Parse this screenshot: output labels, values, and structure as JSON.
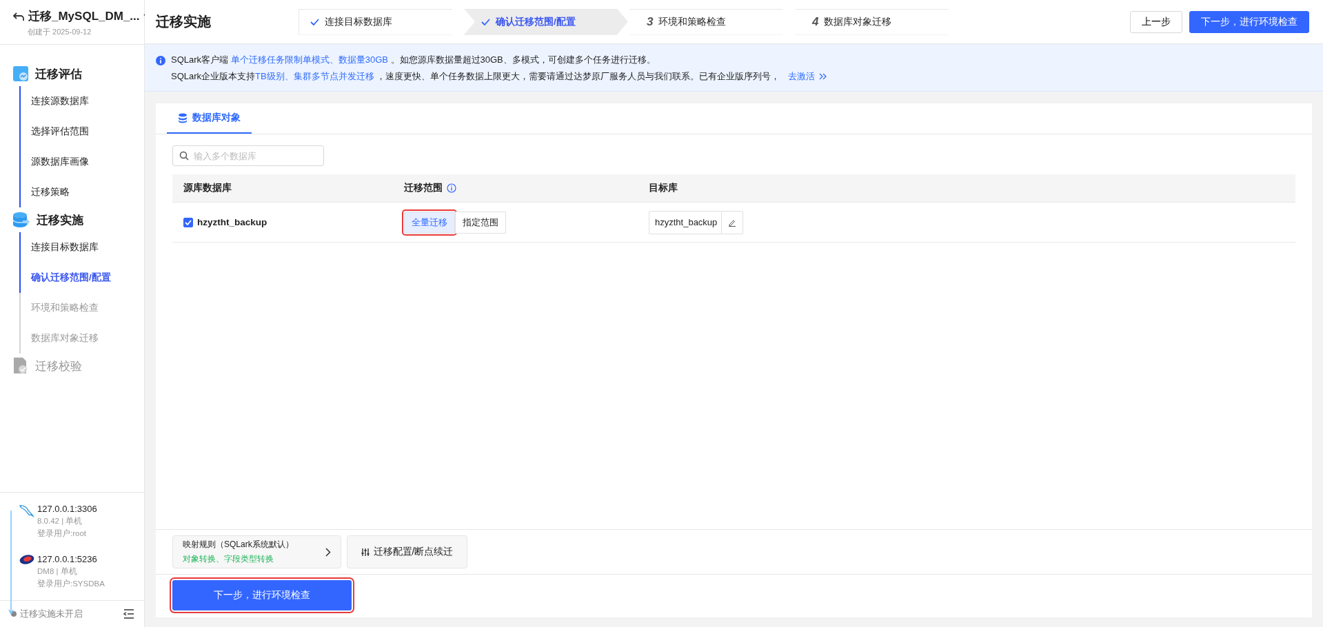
{
  "project": {
    "title": "迁移_MySQL_DM_...",
    "created": "创建于 2025-09-12"
  },
  "sidebar": {
    "stages": [
      {
        "title": "迁移评估",
        "disabled": false,
        "children": [
          {
            "label": "连接源数据库",
            "selected": false,
            "disabled": false
          },
          {
            "label": "选择评估范围",
            "selected": false,
            "disabled": false
          },
          {
            "label": "源数据库画像",
            "selected": false,
            "disabled": false
          },
          {
            "label": "迁移策略",
            "selected": false,
            "disabled": false
          }
        ]
      },
      {
        "title": "迁移实施",
        "disabled": false,
        "children": [
          {
            "label": "连接目标数据库",
            "selected": false,
            "disabled": false
          },
          {
            "label": "确认迁移范围/配置",
            "selected": true,
            "disabled": false
          },
          {
            "label": "环境和策略检查",
            "selected": false,
            "disabled": true
          },
          {
            "label": "数据库对象迁移",
            "selected": false,
            "disabled": true
          }
        ]
      },
      {
        "title": "迁移校验",
        "disabled": true
      }
    ]
  },
  "connections": [
    {
      "kind": "mysql",
      "address": "127.0.0.1:3306",
      "version": "8.0.42 | 单机",
      "user": "登录用户:root"
    },
    {
      "kind": "dm",
      "address": "127.0.0.1:5236",
      "version": "DM8 | 单机",
      "user": "登录用户:SYSDBA"
    }
  ],
  "status_bar": {
    "text": "迁移实施未开启"
  },
  "header": {
    "title": "迁移实施",
    "steps": [
      {
        "label": "连接目标数据库",
        "done": true,
        "selected": false
      },
      {
        "label": "确认迁移范围/配置",
        "done": true,
        "selected": true
      },
      {
        "number": "3",
        "label": "环境和策略检查",
        "done": false,
        "selected": false
      },
      {
        "number": "4",
        "label": "数据库对象迁移",
        "done": false,
        "selected": false
      }
    ],
    "prev_button": "上一步",
    "next_button": "下一步，进行环境检查"
  },
  "notice": {
    "lines": [
      {
        "segments": [
          {
            "kind": "plain",
            "text": "SQLark客户端 "
          },
          {
            "kind": "highlight",
            "text": "单个迁移任务限制单模式、数据量30GB"
          },
          {
            "kind": "plain",
            "text": " 。如您源库数据量超过30GB、多模式，可创建多个任务进行迁移。"
          }
        ]
      },
      {
        "segments": [
          {
            "kind": "plain",
            "text": "SQLark企业版本支持"
          },
          {
            "kind": "highlight",
            "text": "TB级别、集群多节点并发迁移"
          },
          {
            "kind": "plain",
            "text": " ，速度更快、单个任务数据上限更大，需要请通过达梦原厂服务人员与我们联系。已有企业版序列号，"
          }
        ],
        "link": "去激活"
      }
    ]
  },
  "tabs": [
    {
      "label": "数据库对象",
      "selected": true
    }
  ],
  "search": {
    "placeholder": "输入多个数据库"
  },
  "table": {
    "columns": [
      {
        "kind": "plain",
        "label": "源库数据库"
      },
      {
        "kind": "info",
        "label": "迁移范围"
      },
      {
        "kind": "plain",
        "label": "目标库"
      }
    ],
    "rows": [
      {
        "name": "hzyztht_backup",
        "checked": true,
        "scope_options": [
          {
            "label": "全量迁移",
            "selected": true,
            "highlighted": true
          },
          {
            "label": "指定范围",
            "selected": false,
            "highlighted": false
          }
        ],
        "target": "hzyztht_backup"
      }
    ]
  },
  "mapping": {
    "title": "映射规则（SQLark系统默认）",
    "detail": "对象转换、字段类型转换"
  },
  "config_button": "迁移配置/断点续迁",
  "next_step": {
    "label": "下一步，进行环境检查",
    "highlighted": true
  }
}
